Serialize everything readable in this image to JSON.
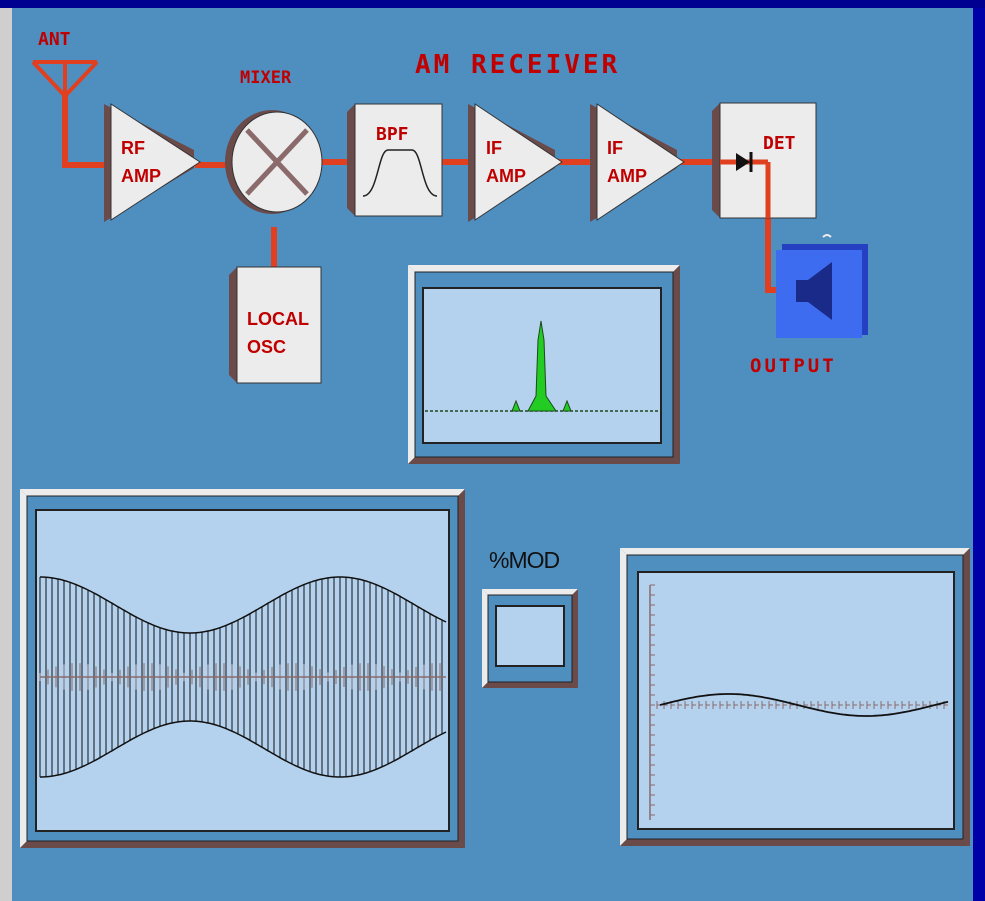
{
  "title": "AM RECEIVER",
  "blocks": {
    "antenna": "ANT",
    "rf_amp": [
      "RF",
      "AMP"
    ],
    "mixer": "MIXER",
    "local_osc": [
      "LOCAL",
      "OSC"
    ],
    "bpf": "BPF",
    "if_amp_1": [
      "IF",
      "AMP"
    ],
    "if_amp_2": [
      "IF",
      "AMP"
    ],
    "detector": "DET",
    "output": "OUTPUT"
  },
  "mod_label": "%MOD",
  "colors": {
    "background": "#4f8fc0",
    "signal_wire": "#e04020",
    "block_face": "#ececec",
    "screen": "#b4d2ee",
    "spectrum_peak": "#22cc22",
    "speaker": "#3d6cf0"
  },
  "icons": [
    "antenna-icon",
    "mixer-x-icon",
    "bandpass-curve-icon",
    "diode-icon",
    "speaker-icon"
  ]
}
